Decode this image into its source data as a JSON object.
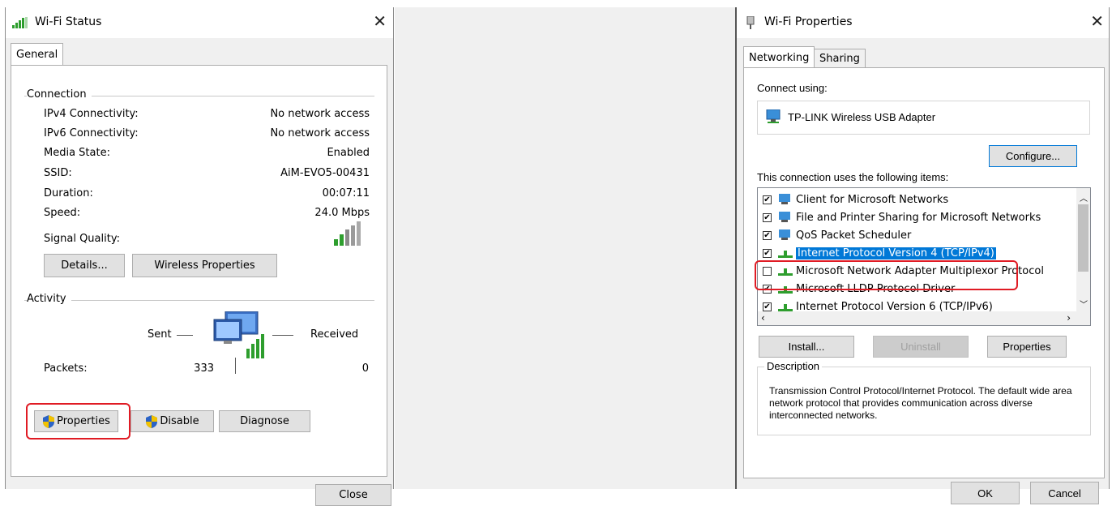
{
  "status_window": {
    "title": "Wi-Fi Status",
    "tab": "General",
    "connection_label": "Connection",
    "rows": [
      {
        "label": "IPv4 Connectivity:",
        "value": "No network access"
      },
      {
        "label": "IPv6 Connectivity:",
        "value": "No network access"
      },
      {
        "label": "Media State:",
        "value": "Enabled"
      },
      {
        "label": "SSID:",
        "value": "AiM-EVO5-00431"
      },
      {
        "label": "Duration:",
        "value": "00:07:11"
      },
      {
        "label": "Speed:",
        "value": "24.0 Mbps"
      }
    ],
    "signal_label": "Signal Quality:",
    "details_button": "Details...",
    "wireless_properties_button": "Wireless Properties",
    "activity_label": "Activity",
    "sent_label": "Sent",
    "received_label": "Received",
    "packets_label": "Packets:",
    "packets_sent": "333",
    "packets_received": "0",
    "properties_button": "Properties",
    "disable_button": "Disable",
    "diagnose_button": "Diagnose",
    "close_button": "Close"
  },
  "properties_window": {
    "title": "Wi-Fi Properties",
    "tabs": [
      "Networking",
      "Sharing"
    ],
    "connect_using_label": "Connect using:",
    "adapter_name": "TP-LINK Wireless USB Adapter",
    "configure_button": "Configure...",
    "items_label": "This connection uses the following items:",
    "items": [
      {
        "label": "Client for Microsoft Networks",
        "checked": "✔"
      },
      {
        "label": "File and Printer Sharing for Microsoft Networks",
        "checked": "✔"
      },
      {
        "label": "QoS Packet Scheduler",
        "checked": "✔"
      },
      {
        "label": "Internet Protocol Version 4 (TCP/IPv4)",
        "checked": "✔"
      },
      {
        "label": "Microsoft Network Adapter Multiplexor Protocol",
        "checked": ""
      },
      {
        "label": "Microsoft LLDP Protocol Driver",
        "checked": "✔"
      },
      {
        "label": "Internet Protocol Version 6 (TCP/IPv6)",
        "checked": "✔"
      }
    ],
    "install_button": "Install...",
    "uninstall_button": "Uninstall",
    "properties_button": "Properties",
    "description_label": "Description",
    "description_text": "Transmission Control Protocol/Internet Protocol. The default wide area network protocol that provides communication across diverse interconnected networks.",
    "ok_button": "OK",
    "cancel_button": "Cancel"
  },
  "colors": {
    "highlight_red": "#e01b24",
    "selection_blue": "#0078d7",
    "signal_green": "#2e9e2e"
  }
}
